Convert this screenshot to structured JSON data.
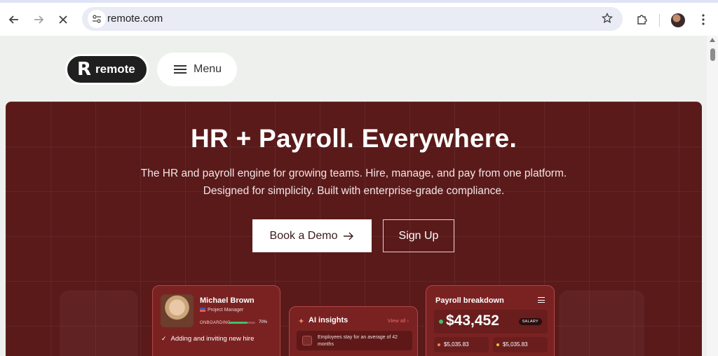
{
  "browser": {
    "url": "remote.com",
    "back_icon": "arrow-left-icon",
    "forward_icon": "arrow-right-icon",
    "stop_icon": "close-icon"
  },
  "site": {
    "logo_text": "remote",
    "menu_label": "Menu"
  },
  "hero": {
    "title": "HR + Payroll. Everywhere.",
    "subtitle_line1": "The HR and payroll engine for growing teams. Hire, manage, and pay from one platform.",
    "subtitle_line2": "Designed for simplicity. Built with enterprise-grade compliance.",
    "demo_label": "Book a Demo",
    "signup_label": "Sign Up"
  },
  "profile_card": {
    "name": "Michael Brown",
    "role": "Project Manager",
    "onboarding_label": "ONBOARDING",
    "onboarding_progress": 0.7,
    "onboarding_pct": "70%",
    "task": "Adding and inviting new hire"
  },
  "ai_card": {
    "title": "AI insights",
    "view_all": "View all",
    "insight": "Employees stay for an average of 42 months"
  },
  "payroll_card": {
    "title": "Payroll breakdown",
    "amount": "$43,452",
    "badge": "SALARY",
    "sub1": "$5,035.83",
    "sub2": "$5,035.83"
  },
  "colors": {
    "hero_bg": "#5a1a1a",
    "card_bg": "#7a2222",
    "accent_green": "#3fc06a"
  }
}
